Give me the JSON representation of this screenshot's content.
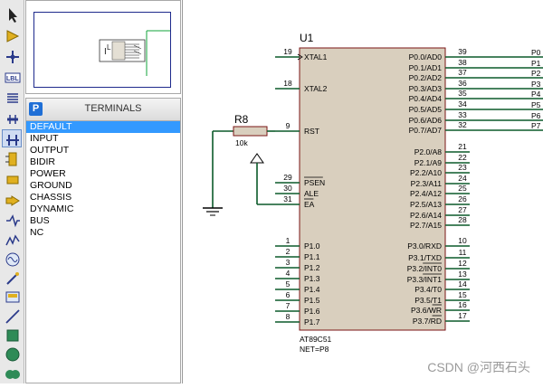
{
  "toolbar": {
    "tools": [
      {
        "icon": "selection-arrow-icon",
        "active": false
      },
      {
        "icon": "component-mode-icon",
        "active": false
      },
      {
        "icon": "junction-dot-icon",
        "active": false
      },
      {
        "icon": "wire-label-icon",
        "active": false
      },
      {
        "icon": "text-script-icon",
        "active": false
      },
      {
        "icon": "buses-icon",
        "active": false
      },
      {
        "icon": "terminals-mode-icon",
        "active": true
      },
      {
        "icon": "device-pins-icon",
        "active": false
      },
      {
        "icon": "graph-mode-icon",
        "active": false
      },
      {
        "icon": "tape-recorder-icon",
        "active": false
      },
      {
        "icon": "generator-mode-icon",
        "active": false
      },
      {
        "icon": "voltage-probe-icon",
        "active": false
      },
      {
        "icon": "current-probe-icon",
        "active": false
      },
      {
        "icon": "virtual-instruments-icon",
        "active": false
      },
      {
        "icon": "line-tool-icon",
        "active": false
      },
      {
        "icon": "box-tool-icon",
        "active": false
      },
      {
        "icon": "circle-tool-icon",
        "active": false
      },
      {
        "icon": "arc-tool-icon",
        "active": false
      }
    ],
    "wire_label_text": "LBL"
  },
  "panel": {
    "badge": "P",
    "title": "TERMINALS",
    "items": [
      "DEFAULT",
      "INPUT",
      "OUTPUT",
      "BIDIR",
      "POWER",
      "GROUND",
      "CHASSIS",
      "DYNAMIC",
      "BUS",
      "NC"
    ],
    "selected_index": 0
  },
  "schematic": {
    "chip_ref": "U1",
    "chip_part": "AT89C51",
    "chip_net": "NET=P8",
    "left_pins": [
      {
        "num": "19",
        "name": "XTAL1",
        "bar": false
      },
      {
        "num": "18",
        "name": "XTAL2",
        "bar": false
      },
      {
        "num": "9",
        "name": "RST",
        "bar": false
      },
      {
        "num": "29",
        "name": "PSEN",
        "bar": true
      },
      {
        "num": "30",
        "name": "ALE",
        "bar": false
      },
      {
        "num": "31",
        "name": "EA",
        "bar": true
      },
      {
        "num": "1",
        "name": "P1.0",
        "bar": false
      },
      {
        "num": "2",
        "name": "P1.1",
        "bar": false
      },
      {
        "num": "3",
        "name": "P1.2",
        "bar": false
      },
      {
        "num": "4",
        "name": "P1.3",
        "bar": false
      },
      {
        "num": "5",
        "name": "P1.4",
        "bar": false
      },
      {
        "num": "6",
        "name": "P1.5",
        "bar": false
      },
      {
        "num": "7",
        "name": "P1.6",
        "bar": false
      },
      {
        "num": "8",
        "name": "P1.7",
        "bar": false
      }
    ],
    "right_pins": [
      {
        "num": "39",
        "name": "P0.0/AD0",
        "ext": "P0"
      },
      {
        "num": "38",
        "name": "P0.1/AD1",
        "ext": "P1"
      },
      {
        "num": "37",
        "name": "P0.2/AD2",
        "ext": "P2"
      },
      {
        "num": "36",
        "name": "P0.3/AD3",
        "ext": "P3"
      },
      {
        "num": "35",
        "name": "P0.4/AD4",
        "ext": "P4"
      },
      {
        "num": "34",
        "name": "P0.5/AD5",
        "ext": "P5"
      },
      {
        "num": "33",
        "name": "P0.6/AD6",
        "ext": "P6"
      },
      {
        "num": "32",
        "name": "P0.7/AD7",
        "ext": "P7"
      },
      {
        "num": "21",
        "name": "P2.0/A8",
        "ext": ""
      },
      {
        "num": "22",
        "name": "P2.1/A9",
        "ext": ""
      },
      {
        "num": "23",
        "name": "P2.2/A10",
        "ext": ""
      },
      {
        "num": "24",
        "name": "P2.3/A11",
        "ext": ""
      },
      {
        "num": "25",
        "name": "P2.4/A12",
        "ext": ""
      },
      {
        "num": "26",
        "name": "P2.5/A13",
        "ext": ""
      },
      {
        "num": "27",
        "name": "P2.6/A14",
        "ext": ""
      },
      {
        "num": "28",
        "name": "P2.7/A15",
        "ext": ""
      },
      {
        "num": "10",
        "name": "P3.0/RXD",
        "ext": ""
      },
      {
        "num": "11",
        "name": "P3.1/TXD",
        "ext": ""
      },
      {
        "num": "12",
        "name": "P3.2/INT0",
        "ext": "",
        "bar_from": 5
      },
      {
        "num": "13",
        "name": "P3.3/INT1",
        "ext": "",
        "bar_from": 5
      },
      {
        "num": "14",
        "name": "P3.4/T0",
        "ext": ""
      },
      {
        "num": "15",
        "name": "P3.5/T1",
        "ext": ""
      },
      {
        "num": "16",
        "name": "P3.6/WR",
        "ext": "",
        "bar_from": 5
      },
      {
        "num": "17",
        "name": "P3.7/RD",
        "ext": "",
        "bar_from": 5
      }
    ],
    "resistor_ref": "R8",
    "resistor_value": "10k",
    "colors": {
      "wire": "#0b5a2a",
      "chip_fill": "#d9cfbe",
      "chip_border": "#7a1414",
      "pin_text": "#000000",
      "resistor_fill": "#d9cfbe"
    }
  },
  "watermark": "CSDN @河西石头"
}
